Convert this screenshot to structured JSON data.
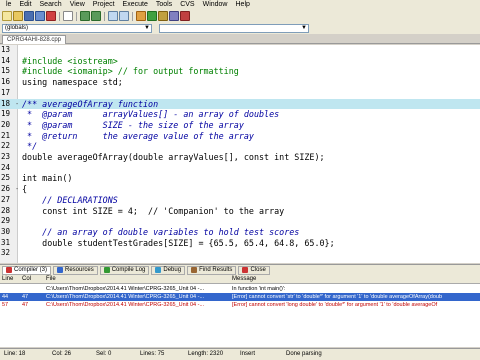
{
  "menu": [
    "le",
    "Edit",
    "Search",
    "View",
    "Project",
    "Execute",
    "Tools",
    "CVS",
    "Window",
    "Help"
  ],
  "toolbar": {
    "globals_value": "(globals)"
  },
  "file_tab": "CPRG4AHI-828.cpp",
  "code": [
    {
      "n": "13",
      "fold": "",
      "hl": false,
      "text": ""
    },
    {
      "n": "14",
      "fold": "",
      "hl": false,
      "text": "#include <iostream>"
    },
    {
      "n": "15",
      "fold": "",
      "hl": false,
      "text": "#include <iomanip> // for output formatting"
    },
    {
      "n": "16",
      "fold": "",
      "hl": false,
      "text": "using namespace std;"
    },
    {
      "n": "17",
      "fold": "",
      "hl": false,
      "text": ""
    },
    {
      "n": "18",
      "fold": "-",
      "hl": true,
      "text": "/** averageOfArray function"
    },
    {
      "n": "19",
      "fold": "",
      "hl": false,
      "text": " *  @param      arrayValues[] - an array of doubles"
    },
    {
      "n": "20",
      "fold": "",
      "hl": false,
      "text": " *  @param      SIZE - the size of the array"
    },
    {
      "n": "21",
      "fold": "",
      "hl": false,
      "text": " *  @return     the average value of the array"
    },
    {
      "n": "22",
      "fold": "",
      "hl": false,
      "text": " */"
    },
    {
      "n": "23",
      "fold": "",
      "hl": false,
      "text": "double averageOfArray(double arrayValues[], const int SIZE);"
    },
    {
      "n": "24",
      "fold": "",
      "hl": false,
      "text": ""
    },
    {
      "n": "25",
      "fold": "",
      "hl": false,
      "text": "int main()"
    },
    {
      "n": "26",
      "fold": "-",
      "hl": false,
      "text": "{"
    },
    {
      "n": "27",
      "fold": "",
      "hl": false,
      "text": "    // DECLARATIONS"
    },
    {
      "n": "28",
      "fold": "",
      "hl": false,
      "text": "    const int SIZE = 4;  // 'Companion' to the array"
    },
    {
      "n": "29",
      "fold": "",
      "hl": false,
      "text": ""
    },
    {
      "n": "30",
      "fold": "",
      "hl": false,
      "text": "    // an array of double variables to hold test scores"
    },
    {
      "n": "31",
      "fold": "",
      "hl": false,
      "text": "    double studentTestGrades[SIZE] = {65.5, 65.4, 64.8, 65.0};"
    },
    {
      "n": "32",
      "fold": "",
      "hl": false,
      "text": ""
    }
  ],
  "bottom_tabs": [
    {
      "label": "Compiler (3)",
      "color": "#cc3333",
      "active": true
    },
    {
      "label": "Resources",
      "color": "#3366cc",
      "active": false
    },
    {
      "label": "Compile Log",
      "color": "#339933",
      "active": false
    },
    {
      "label": "Debug",
      "color": "#3399cc",
      "active": false
    },
    {
      "label": "Find Results",
      "color": "#996633",
      "active": false
    },
    {
      "label": "Close",
      "color": "#cc3333",
      "active": false
    }
  ],
  "compiler": {
    "headers": {
      "line": "Line",
      "col": "Col",
      "file": "File",
      "message": "Message"
    },
    "rows": [
      {
        "line": "",
        "col": "",
        "file": "C:\\Users\\Thom\\Dropbox\\2014.41 Winter\\CPRG-3265_Unit 04 -...",
        "message": "In function 'int main()':",
        "state": "normal"
      },
      {
        "line": "44",
        "col": "47",
        "file": "C:\\Users\\Thom\\Dropbox\\2014.41 Winter\\CPRG-3265_Unit 04 -...",
        "message": "[Error] cannot convert 'str' to 'double*' for argument '1' to 'double averageOfArray(doub",
        "state": "selected"
      },
      {
        "line": "57",
        "col": "47",
        "file": "C:\\Users\\Thom\\Dropbox\\2014.41 Winter\\CPRG-3265_Unit 04 -...",
        "message": "[Error] cannot convert 'long double' to 'double*' for argument '1' to 'double averageOf",
        "state": "error"
      }
    ]
  },
  "status": {
    "line": "Line: 18",
    "col": "Col: 26",
    "sel": "Sel: 0",
    "lines": "Lines: 75",
    "length": "Length: 2320",
    "mode": "Insert",
    "message": "Done parsing"
  }
}
